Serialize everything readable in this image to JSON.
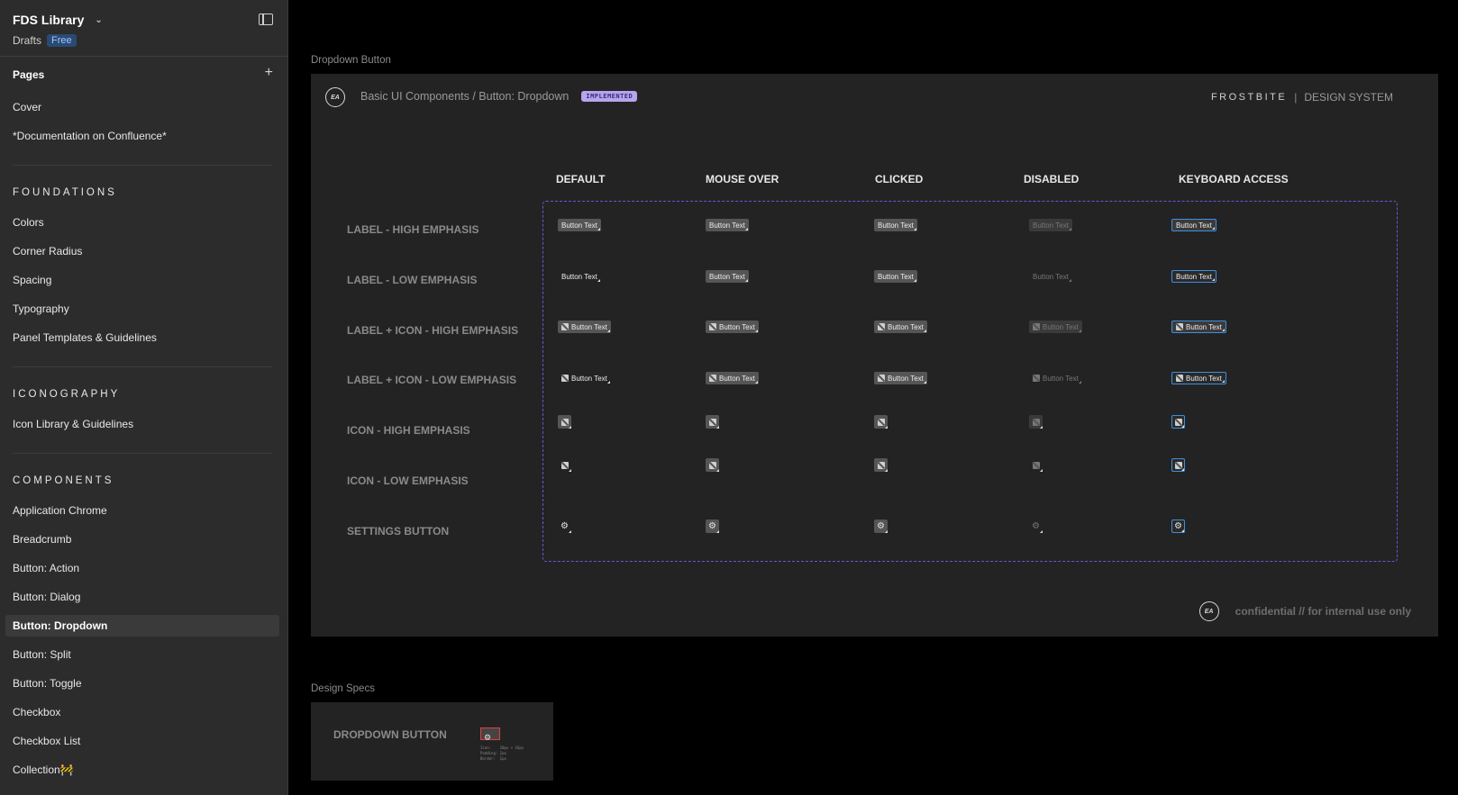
{
  "sidebar": {
    "app_title": "FDS Library",
    "drafts": "Drafts",
    "plan_badge": "Free",
    "pages_label": "Pages",
    "top_pages": [
      "Cover",
      "*Documentation on Confluence*"
    ],
    "foundations_label": "FOUNDATIONS",
    "foundations": [
      "Colors",
      "Corner Radius",
      "Spacing",
      "Typography",
      "Panel Templates & Guidelines"
    ],
    "iconography_label": "ICONOGRAPHY",
    "iconography": [
      "Icon Library & Guidelines"
    ],
    "components_label": "COMPONENTS",
    "components": [
      "Application Chrome",
      "Breadcrumb",
      "Button: Action",
      "Button: Dialog",
      "Button: Dropdown",
      "Button: Split",
      "Button: Toggle",
      "Checkbox",
      "Checkbox List",
      "Collection🚧"
    ],
    "active_page": "Button: Dropdown"
  },
  "canvas": {
    "frame_label": "Dropdown Button",
    "ea_logo_text": "EA",
    "frame_title": "Basic UI Components / Button: Dropdown",
    "status_badge": "IMPLEMENTED",
    "brand_primary": "FROSTBITE",
    "brand_separator": "|",
    "brand_secondary": "DESIGN SYSTEM",
    "columns": [
      "DEFAULT",
      "MOUSE OVER",
      "CLICKED",
      "DISABLED",
      "KEYBOARD ACCESS"
    ],
    "rows": [
      "LABEL - HIGH EMPHASIS",
      "LABEL - LOW EMPHASIS",
      "LABEL + ICON - HIGH EMPHASIS",
      "LABEL + ICON - LOW EMPHASIS",
      "ICON - HIGH EMPHASIS",
      "ICON - LOW EMPHASIS",
      "SETTINGS BUTTON"
    ],
    "button_text": "Button Text",
    "confidential": "confidential // for internal use only",
    "specs_label": "Design Specs",
    "specs_title": "DROPDOWN BUTTON",
    "spec_lines": "Icon:    20px × 16px\nPadding: 2px\nBorder:  1px"
  },
  "colors": {
    "accent_focus": "#3e8fe0",
    "dashed_border": "#6a55d6",
    "implemented_badge": "#b7a4ee"
  }
}
